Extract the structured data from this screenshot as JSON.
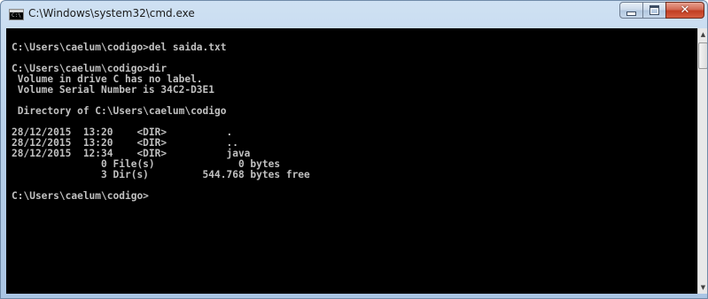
{
  "window": {
    "title": "C:\\Windows\\system32\\cmd.exe",
    "icon": "cmd-icon",
    "icon_text": "C:\\"
  },
  "controls": {
    "minimize": "minimize-icon",
    "maximize": "maximize-icon",
    "close_label": "✕"
  },
  "console": {
    "lines": [
      "",
      "C:\\Users\\caelum\\codigo>del saida.txt",
      "",
      "C:\\Users\\caelum\\codigo>dir",
      " Volume in drive C has no label.",
      " Volume Serial Number is 34C2-D3E1",
      "",
      " Directory of C:\\Users\\caelum\\codigo",
      "",
      "28/12/2015  13:20    <DIR>          .",
      "28/12/2015  13:20    <DIR>          ..",
      "28/12/2015  12:34    <DIR>          java",
      "               0 File(s)              0 bytes",
      "               3 Dir(s)         544.768 bytes free",
      "",
      "C:\\Users\\caelum\\codigo>"
    ]
  },
  "scrollbar": {
    "up_arrow": "▲",
    "down_arrow": "▼"
  },
  "colors": {
    "console_background": "#000000",
    "console_text": "#c0c0c0",
    "close_button": "#c23d22"
  }
}
